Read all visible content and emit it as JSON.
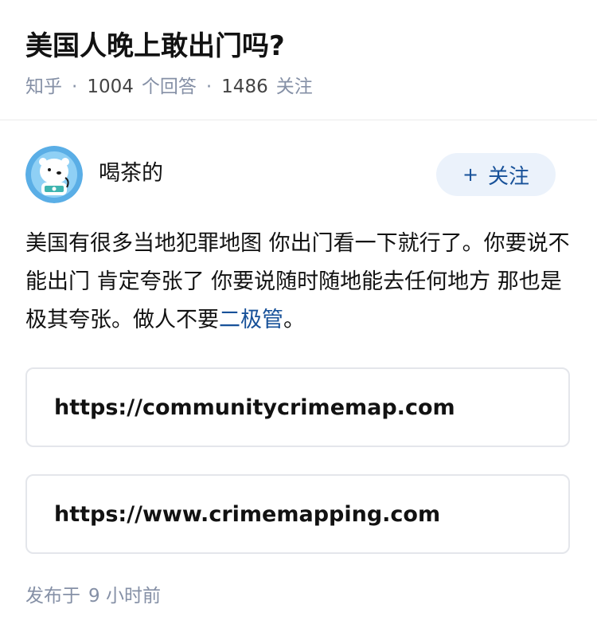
{
  "question": {
    "title": "美国人晚上敢出门吗?",
    "source": "知乎",
    "answer_count": "1004",
    "answer_label": "个回答",
    "follower_count": "1486",
    "follower_label": "关注"
  },
  "author": {
    "name": "喝茶的",
    "avatar_icon": "polar-bear-astronaut-avatar",
    "follow_button_label": "关注",
    "follow_button_icon": "+"
  },
  "answer": {
    "text_before_link": "美国有很多当地犯罪地图 你出门看一下就行了。你要说不能出门 肯定夸张了 你要说随时随地能去任何地方 那也是极其夸张。做人不要",
    "link_term": "二极管",
    "text_after_link": "。",
    "links": [
      {
        "url": "https://communitycrimemap.com"
      },
      {
        "url": "https://www.crimemapping.com"
      }
    ]
  },
  "publish": {
    "label": "发布于",
    "time": "9 小时前"
  },
  "colors": {
    "link": "#175199",
    "meta": "#8590a6",
    "follow_bg": "#ebf2fb",
    "card_border": "#e4e6eb"
  }
}
